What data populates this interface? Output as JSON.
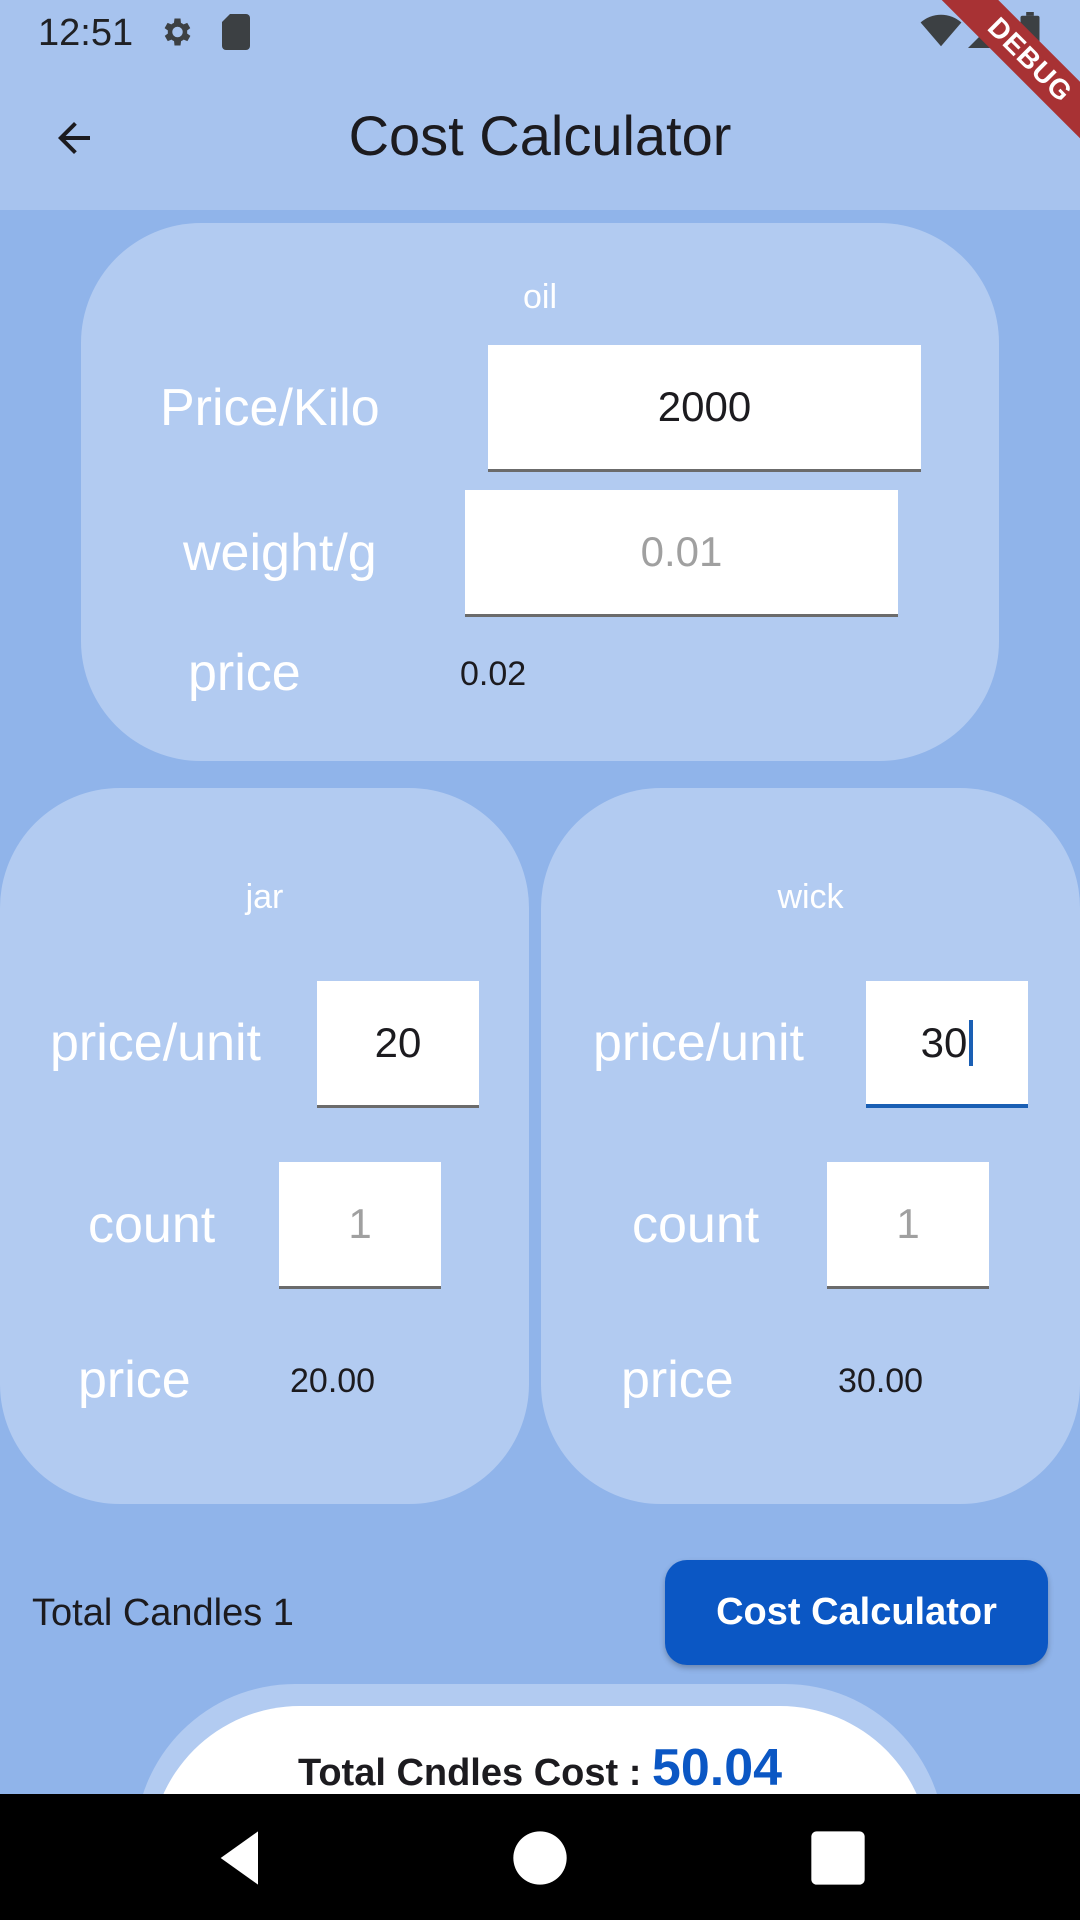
{
  "status_bar": {
    "time": "12:51"
  },
  "app_bar": {
    "title": "Cost Calculator"
  },
  "debug_banner": "DEBUG",
  "oil": {
    "title": "oil",
    "price_per_kilo_label": "Price/Kilo",
    "price_per_kilo_value": "2000",
    "weight_label": "weight/g",
    "weight_placeholder": "0.01",
    "price_label": "price",
    "price_value": "0.02"
  },
  "jar": {
    "title": "jar",
    "price_per_unit_label": "price/unit",
    "price_per_unit_value": "20",
    "count_label": "count",
    "count_placeholder": "1",
    "price_label": "price",
    "price_value": "20.00"
  },
  "wick": {
    "title": "wick",
    "price_per_unit_label": "price/unit",
    "price_per_unit_value": "30",
    "count_label": "count",
    "count_placeholder": "1",
    "price_label": "price",
    "price_value": "30.00"
  },
  "total_candles": "Total Candles 1",
  "calc_button_label": "Cost Calculator",
  "result": {
    "label": "Total Cndles Cost : ",
    "value": "50.04"
  },
  "colors": {
    "background": "#90b4ea",
    "card": "#b2cbf1",
    "accent": "#0b57c4"
  }
}
